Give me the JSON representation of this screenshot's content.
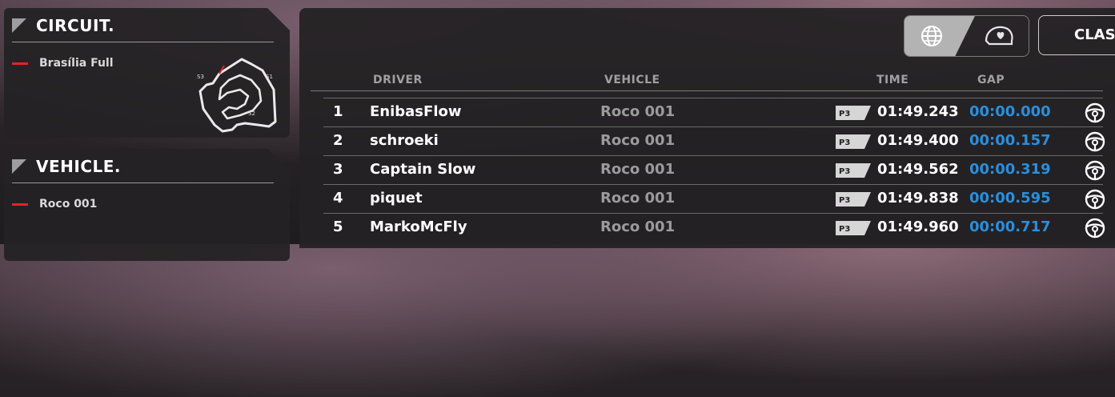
{
  "circuit": {
    "title": "CIRCUIT.",
    "track_name": "Brasília Full",
    "sectors": [
      "S1",
      "S2",
      "S3"
    ]
  },
  "vehicle": {
    "title": "VEHICLE.",
    "vehicle_name": "Roco 001"
  },
  "results": {
    "toggle": {
      "active": "globe-icon",
      "inactive": "helmet-heart-icon"
    },
    "class_button_label": "CLAS",
    "headers": {
      "driver": "DRIVER",
      "vehicle": "VEHICLE",
      "time": "TIME",
      "gap": "GAP"
    },
    "rows": [
      {
        "pos": "1",
        "driver": "EnibasFlow",
        "vehicle": "Roco 001",
        "badge": "P3",
        "time": "01:49.243",
        "gap": "00:00.000"
      },
      {
        "pos": "2",
        "driver": "schroeki",
        "vehicle": "Roco 001",
        "badge": "P3",
        "time": "01:49.400",
        "gap": "00:00.157"
      },
      {
        "pos": "3",
        "driver": "Captain Slow",
        "vehicle": "Roco 001",
        "badge": "P3",
        "time": "01:49.562",
        "gap": "00:00.319"
      },
      {
        "pos": "4",
        "driver": "piquet",
        "vehicle": "Roco 001",
        "badge": "P3",
        "time": "01:49.838",
        "gap": "00:00.595"
      },
      {
        "pos": "5",
        "driver": "MarkoMcFly",
        "vehicle": "Roco 001",
        "badge": "P3",
        "time": "01:49.960",
        "gap": "00:00.717"
      }
    ]
  },
  "colors": {
    "accent_red": "#e0242b",
    "gap_blue": "#2a8fdc"
  }
}
